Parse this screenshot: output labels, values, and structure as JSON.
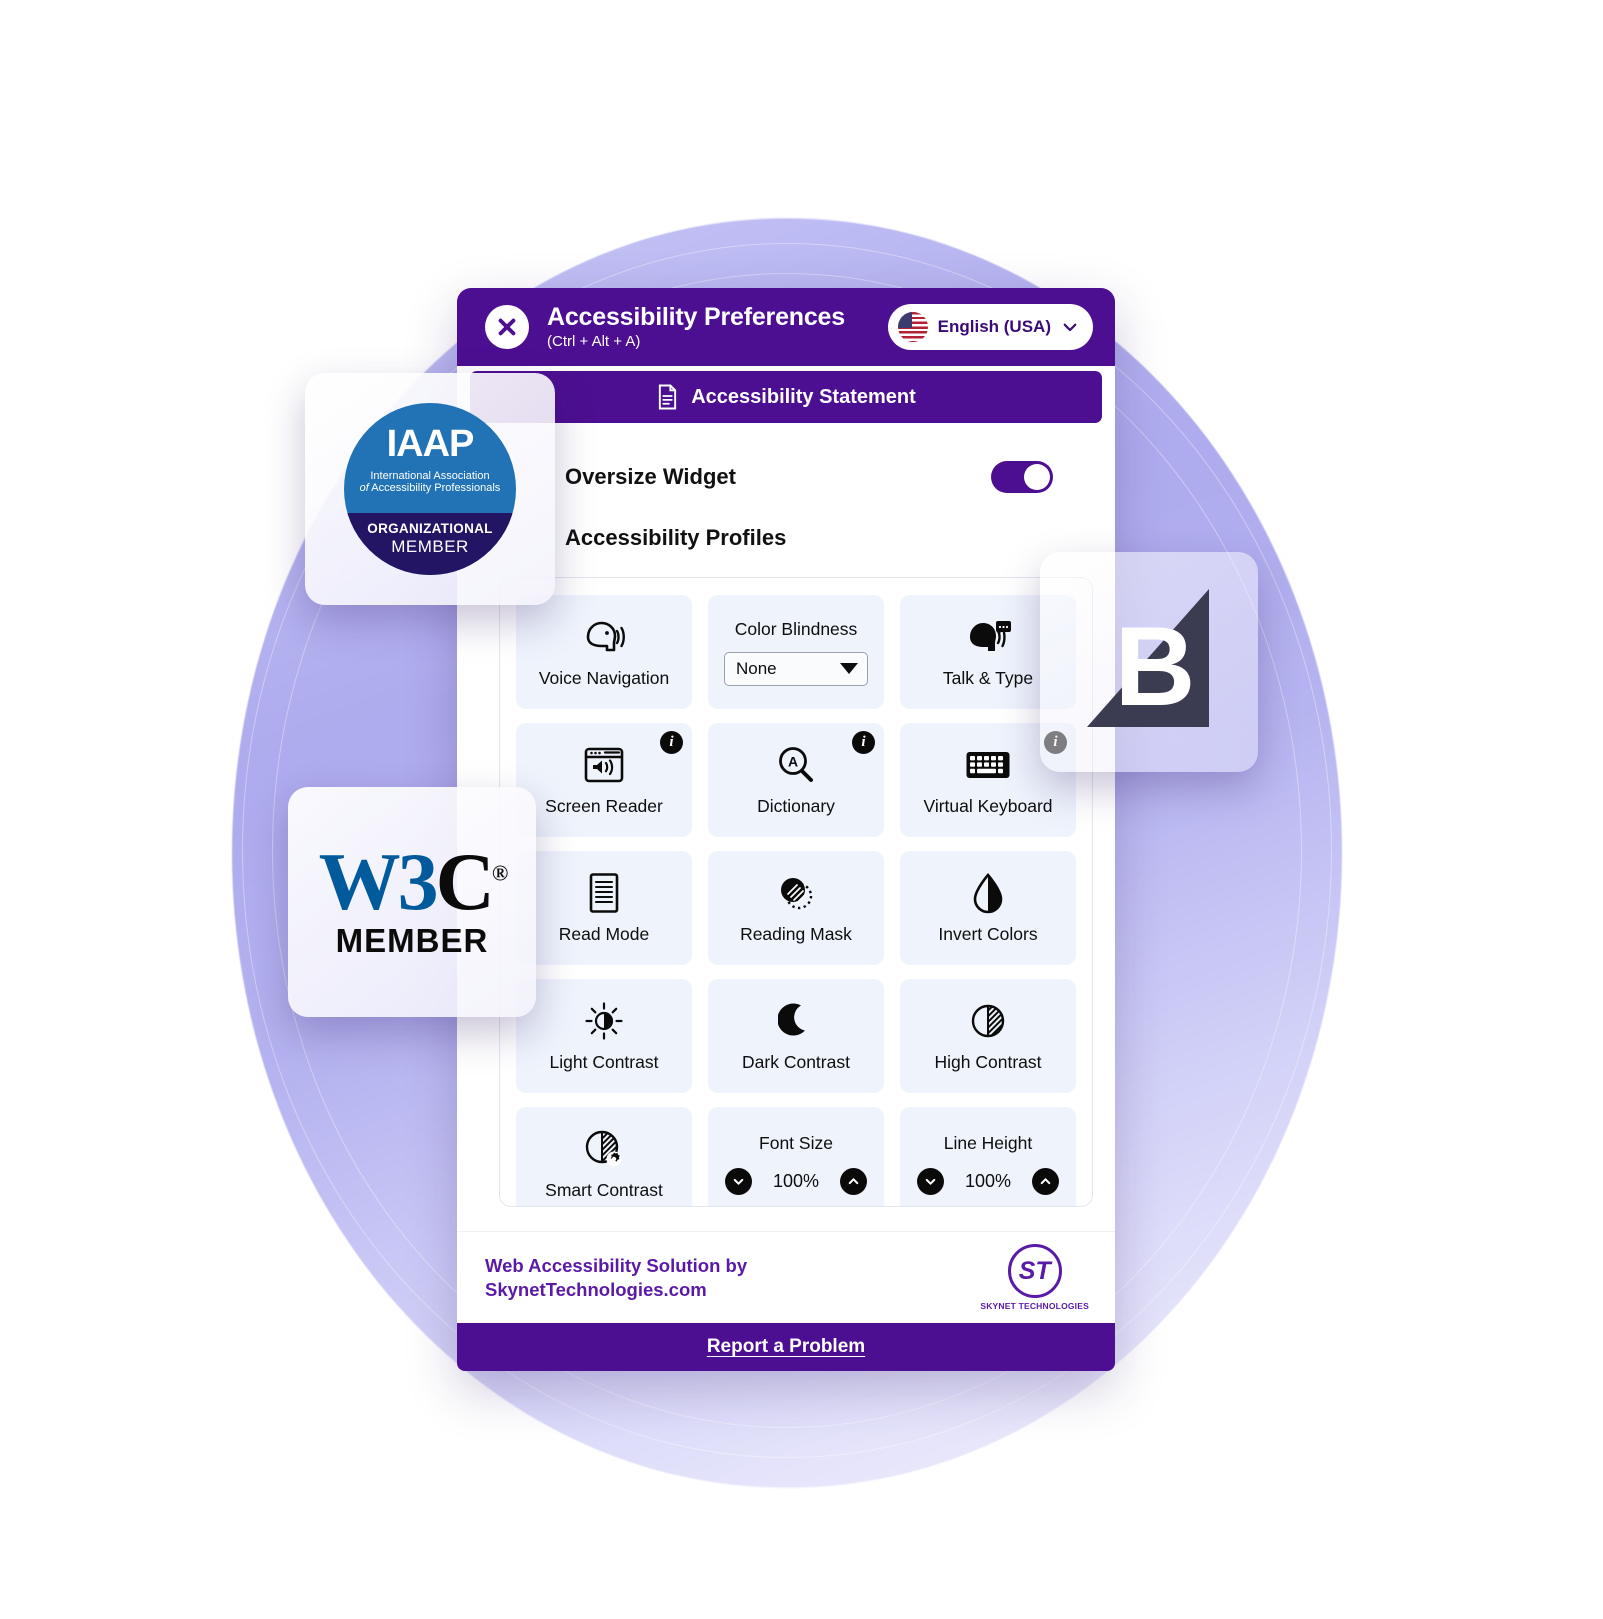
{
  "header": {
    "title": "Accessibility Preferences",
    "shortcut": "(Ctrl + Alt + A)",
    "close_label": "Close",
    "language": "English (USA)",
    "accent_purple": "#4c0f91"
  },
  "statement": {
    "label": "Accessibility Statement"
  },
  "settings": {
    "oversize_widget_label": "Oversize Widget",
    "oversize_widget_state": "on",
    "profiles_label": "Accessibility Profiles"
  },
  "tiles": [
    {
      "label": "Voice Navigation",
      "type": "icon",
      "icon": "speaking-head-icon",
      "info": false
    },
    {
      "label": "Color Blindness",
      "type": "select",
      "icon": "",
      "value": "None",
      "info": false
    },
    {
      "label": "Talk & Type",
      "type": "icon",
      "icon": "talk-type-icon",
      "info": false
    },
    {
      "label": "Screen Reader",
      "type": "icon",
      "icon": "screen-reader-icon",
      "info": true
    },
    {
      "label": "Dictionary",
      "type": "icon",
      "icon": "dictionary-icon",
      "info": true
    },
    {
      "label": "Virtual Keyboard",
      "type": "icon",
      "icon": "keyboard-icon",
      "info": true
    },
    {
      "label": "Read Mode",
      "type": "icon",
      "icon": "document-lines-icon",
      "info": false
    },
    {
      "label": "Reading Mask",
      "type": "icon",
      "icon": "reading-mask-icon",
      "info": false
    },
    {
      "label": "Invert Colors",
      "type": "icon",
      "icon": "droplet-half-icon",
      "info": false
    },
    {
      "label": "Light Contrast",
      "type": "icon",
      "icon": "sun-half-icon",
      "info": false
    },
    {
      "label": "Dark Contrast",
      "type": "icon",
      "icon": "moon-icon",
      "info": false
    },
    {
      "label": "High Contrast",
      "type": "icon",
      "icon": "circle-half-hatch-icon",
      "info": false
    },
    {
      "label": "Smart Contrast",
      "type": "icon",
      "icon": "circle-hatch-gear-icon",
      "info": false
    },
    {
      "label": "Font Size",
      "type": "stepper",
      "value": "100%",
      "info": false
    },
    {
      "label": "Line Height",
      "type": "stepper",
      "value": "100%",
      "info": false
    }
  ],
  "stepper": {
    "decrease_label": "Decrease",
    "increase_label": "Increase"
  },
  "footer": {
    "line1": "Web Accessibility Solution by",
    "line2": "SkynetTechnologies.com",
    "logo_initials": "ST",
    "logo_name": "SKYNET TECHNOLOGIES"
  },
  "report": {
    "label": "Report a Problem"
  },
  "badges": {
    "iaap": {
      "acronym": "IAAP",
      "line1": "International Association",
      "line2_italic": "of",
      "line2": " Accessibility Professionals",
      "org": "ORGANIZATIONAL",
      "member": "MEMBER"
    },
    "w3c": {
      "mark": "W3C",
      "registered": "®",
      "member": "MEMBER"
    },
    "bureau": {
      "mark": "B"
    }
  }
}
